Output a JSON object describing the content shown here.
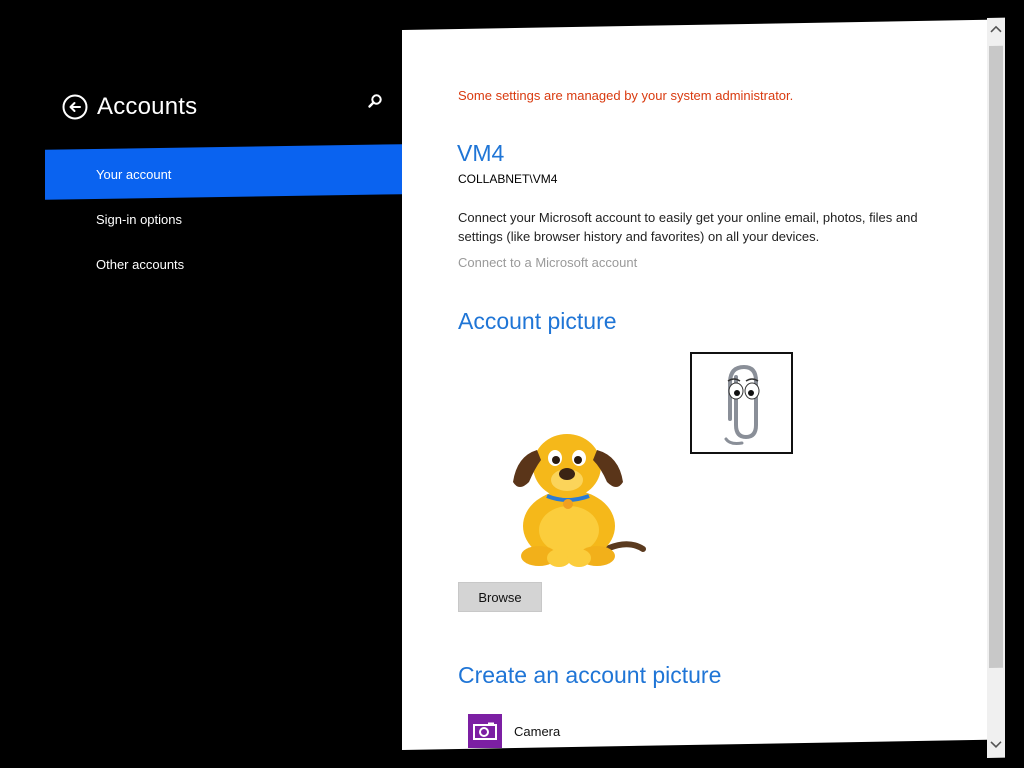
{
  "nav": {
    "title": "Accounts",
    "items": [
      {
        "label": "Your account",
        "selected": true
      },
      {
        "label": "Sign-in options",
        "selected": false
      },
      {
        "label": "Other accounts",
        "selected": false
      }
    ],
    "selected_color": "#0a63f0"
  },
  "content": {
    "admin_note": "Some settings are managed by your system administrator.",
    "account_name": "VM4",
    "account_id": "COLLABNET\\VM4",
    "connect_description": "Connect your Microsoft account to easily get your online email, photos, files and settings (like browser history and favorites) on all your devices.",
    "connect_link": "Connect to a Microsoft account",
    "account_picture_heading": "Account picture",
    "current_picture": "dog-picture",
    "alternate_picture": "paperclip-picture",
    "browse_label": "Browse",
    "create_picture_heading": "Create an account picture",
    "create_apps": [
      {
        "label": "Camera",
        "icon": "camera-icon",
        "tile_color": "#7c1fa3"
      }
    ],
    "heading_color": "#1f75d6",
    "admin_note_color": "#d93a0f"
  }
}
